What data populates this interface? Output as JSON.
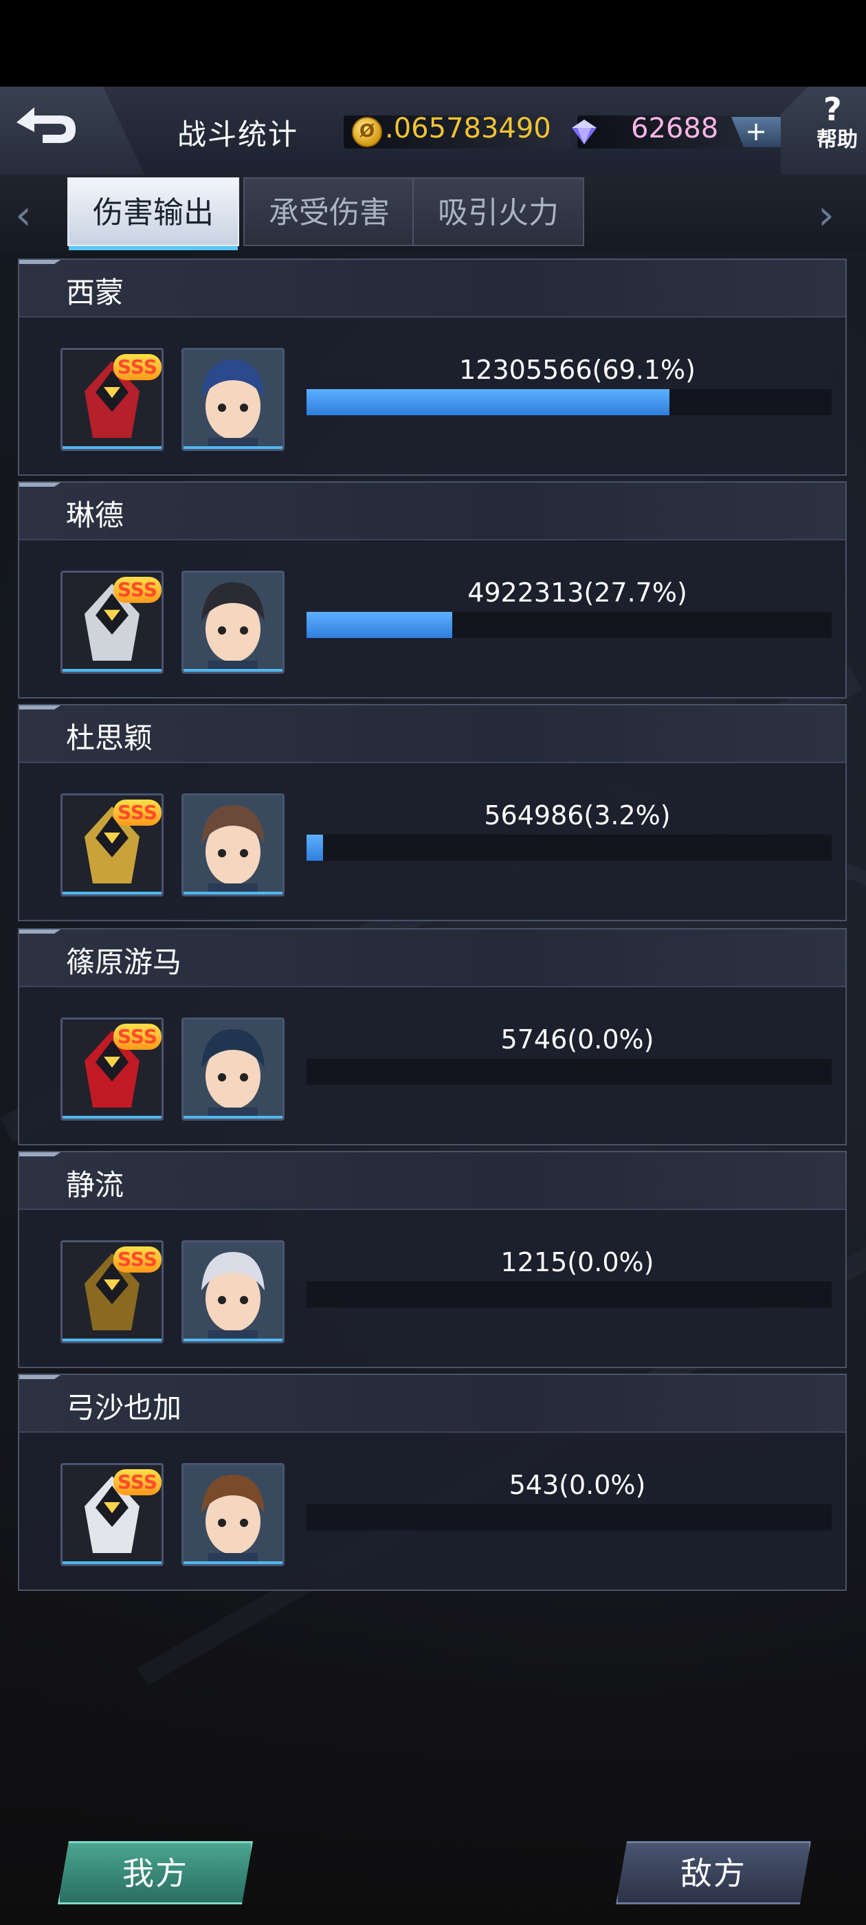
{
  "header": {
    "title": "战斗统计",
    "gold": ".065783490",
    "gems": "62688",
    "plus_label": "+",
    "help_symbol": "?",
    "help_label": "帮助"
  },
  "tabs": [
    {
      "label": "伤害输出",
      "active": true
    },
    {
      "label": "承受伤害",
      "active": false
    },
    {
      "label": "吸引火力",
      "active": false
    }
  ],
  "pilots": [
    {
      "name": "西蒙",
      "value_text": "12305566(69.1%)",
      "share_pct": 69.1,
      "grade": "SSS",
      "mech_color": "#b5202a",
      "pilot_color": "#2a4a8c"
    },
    {
      "name": "琳德",
      "value_text": "4922313(27.7%)",
      "share_pct": 27.7,
      "grade": "SSS",
      "mech_color": "#cfd3da",
      "pilot_color": "#2b2b33"
    },
    {
      "name": "杜思颖",
      "value_text": "564986(3.2%)",
      "share_pct": 3.2,
      "grade": "SSS",
      "mech_color": "#c9a33a",
      "pilot_color": "#6b4a3a"
    },
    {
      "name": "篠原游马",
      "value_text": "5746(0.0%)",
      "share_pct": 0.0,
      "grade": "SSS",
      "mech_color": "#c11a24",
      "pilot_color": "#1f3550"
    },
    {
      "name": "静流",
      "value_text": "1215(0.0%)",
      "share_pct": 0.0,
      "grade": "SSS",
      "mech_color": "#8a6a20",
      "pilot_color": "#d9dbe6"
    },
    {
      "name": "弓沙也加",
      "value_text": "543(0.0%)",
      "share_pct": 0.0,
      "grade": "SSS",
      "mech_color": "#e3e4ea",
      "pilot_color": "#7a4a2a"
    }
  ],
  "footer": {
    "my_side": "我方",
    "enemy_side": "敌方"
  }
}
